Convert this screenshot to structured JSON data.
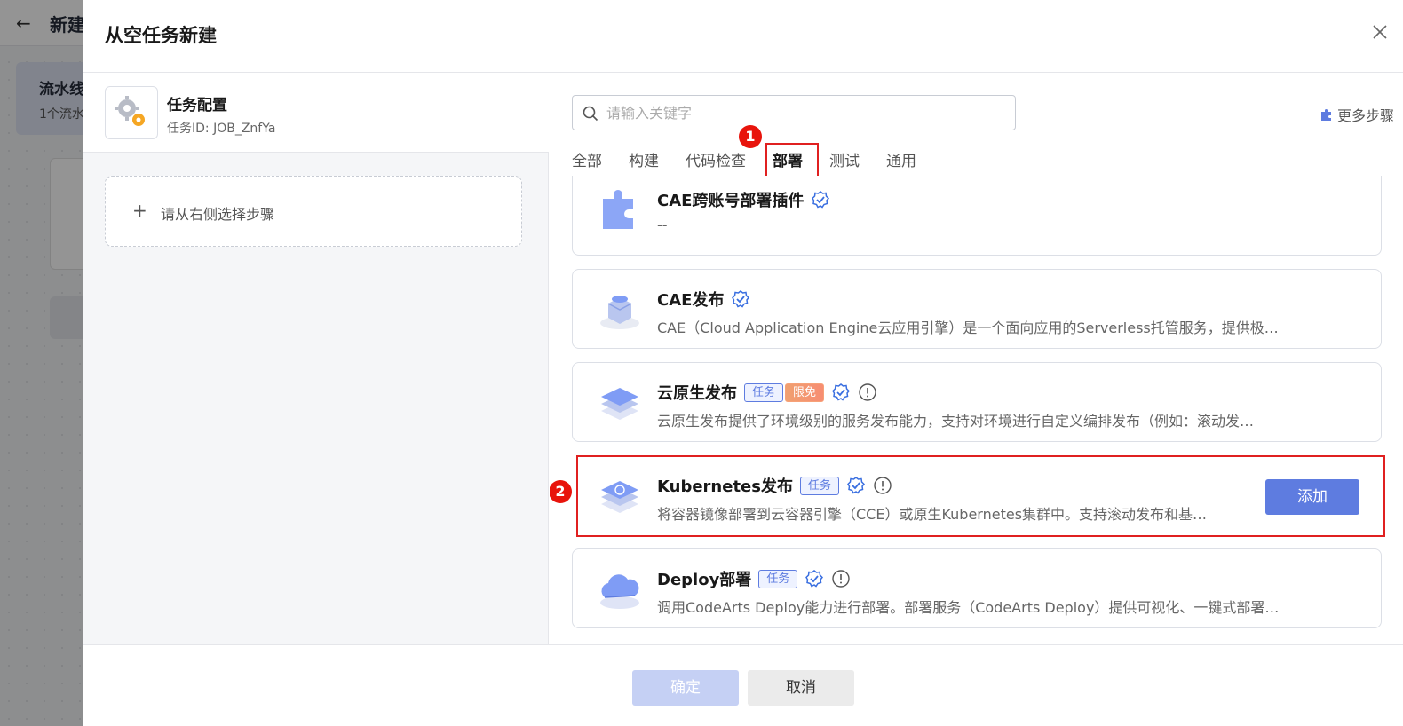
{
  "background": {
    "back_icon": "arrow-left-icon",
    "title": "新建",
    "card_title": "流水线",
    "card_subtitle": "1个流水"
  },
  "drawer": {
    "title": "从空任务新建",
    "close_icon": "close-icon"
  },
  "task": {
    "title": "任务配置",
    "id": "任务ID: JOB_ZnfYa"
  },
  "add_step": {
    "plus": "+",
    "label": "请从右侧选择步骤"
  },
  "search": {
    "placeholder": "请输入关键字"
  },
  "more_steps": {
    "label": "更多步骤"
  },
  "tabs": [
    {
      "label": "全部"
    },
    {
      "label": "构建"
    },
    {
      "label": "代码检查"
    },
    {
      "label": "部署"
    },
    {
      "label": "测试"
    },
    {
      "label": "通用"
    }
  ],
  "active_tab": "部署",
  "markers": {
    "one": "1",
    "two": "2"
  },
  "plugins": [
    {
      "title": "CAE跨账号部署插件",
      "desc": "--",
      "tags": [],
      "verified": true,
      "info": false
    },
    {
      "title": "CAE发布",
      "desc": "CAE（Cloud Application Engine云应用引擎）是一个面向应用的Serverless托管服务，提供极…",
      "tags": [],
      "verified": true,
      "info": false
    },
    {
      "title": "云原生发布",
      "desc": "云原生发布提供了环境级别的服务发布能力，支持对环境进行自定义编排发布（例如：滚动发…",
      "tags": [
        "任务",
        "限免"
      ],
      "verified": true,
      "info": true
    },
    {
      "title": "Kubernetes发布",
      "desc": "将容器镜像部署到云容器引擎（CCE）或原生Kubernetes集群中。支持滚动发布和基…",
      "tags": [
        "任务"
      ],
      "verified": true,
      "info": true,
      "add_label": "添加"
    },
    {
      "title": "Deploy部署",
      "desc": "调用CodeArts Deploy能力进行部署。部署服务（CodeArts Deploy）提供可视化、一键式部署…",
      "tags": [
        "任务"
      ],
      "verified": true,
      "info": true
    }
  ],
  "footer": {
    "confirm": "确定",
    "cancel": "取消"
  },
  "colors": {
    "primary": "#5e7ce0",
    "highlight": "#e02020",
    "marker": "#e8140c"
  }
}
